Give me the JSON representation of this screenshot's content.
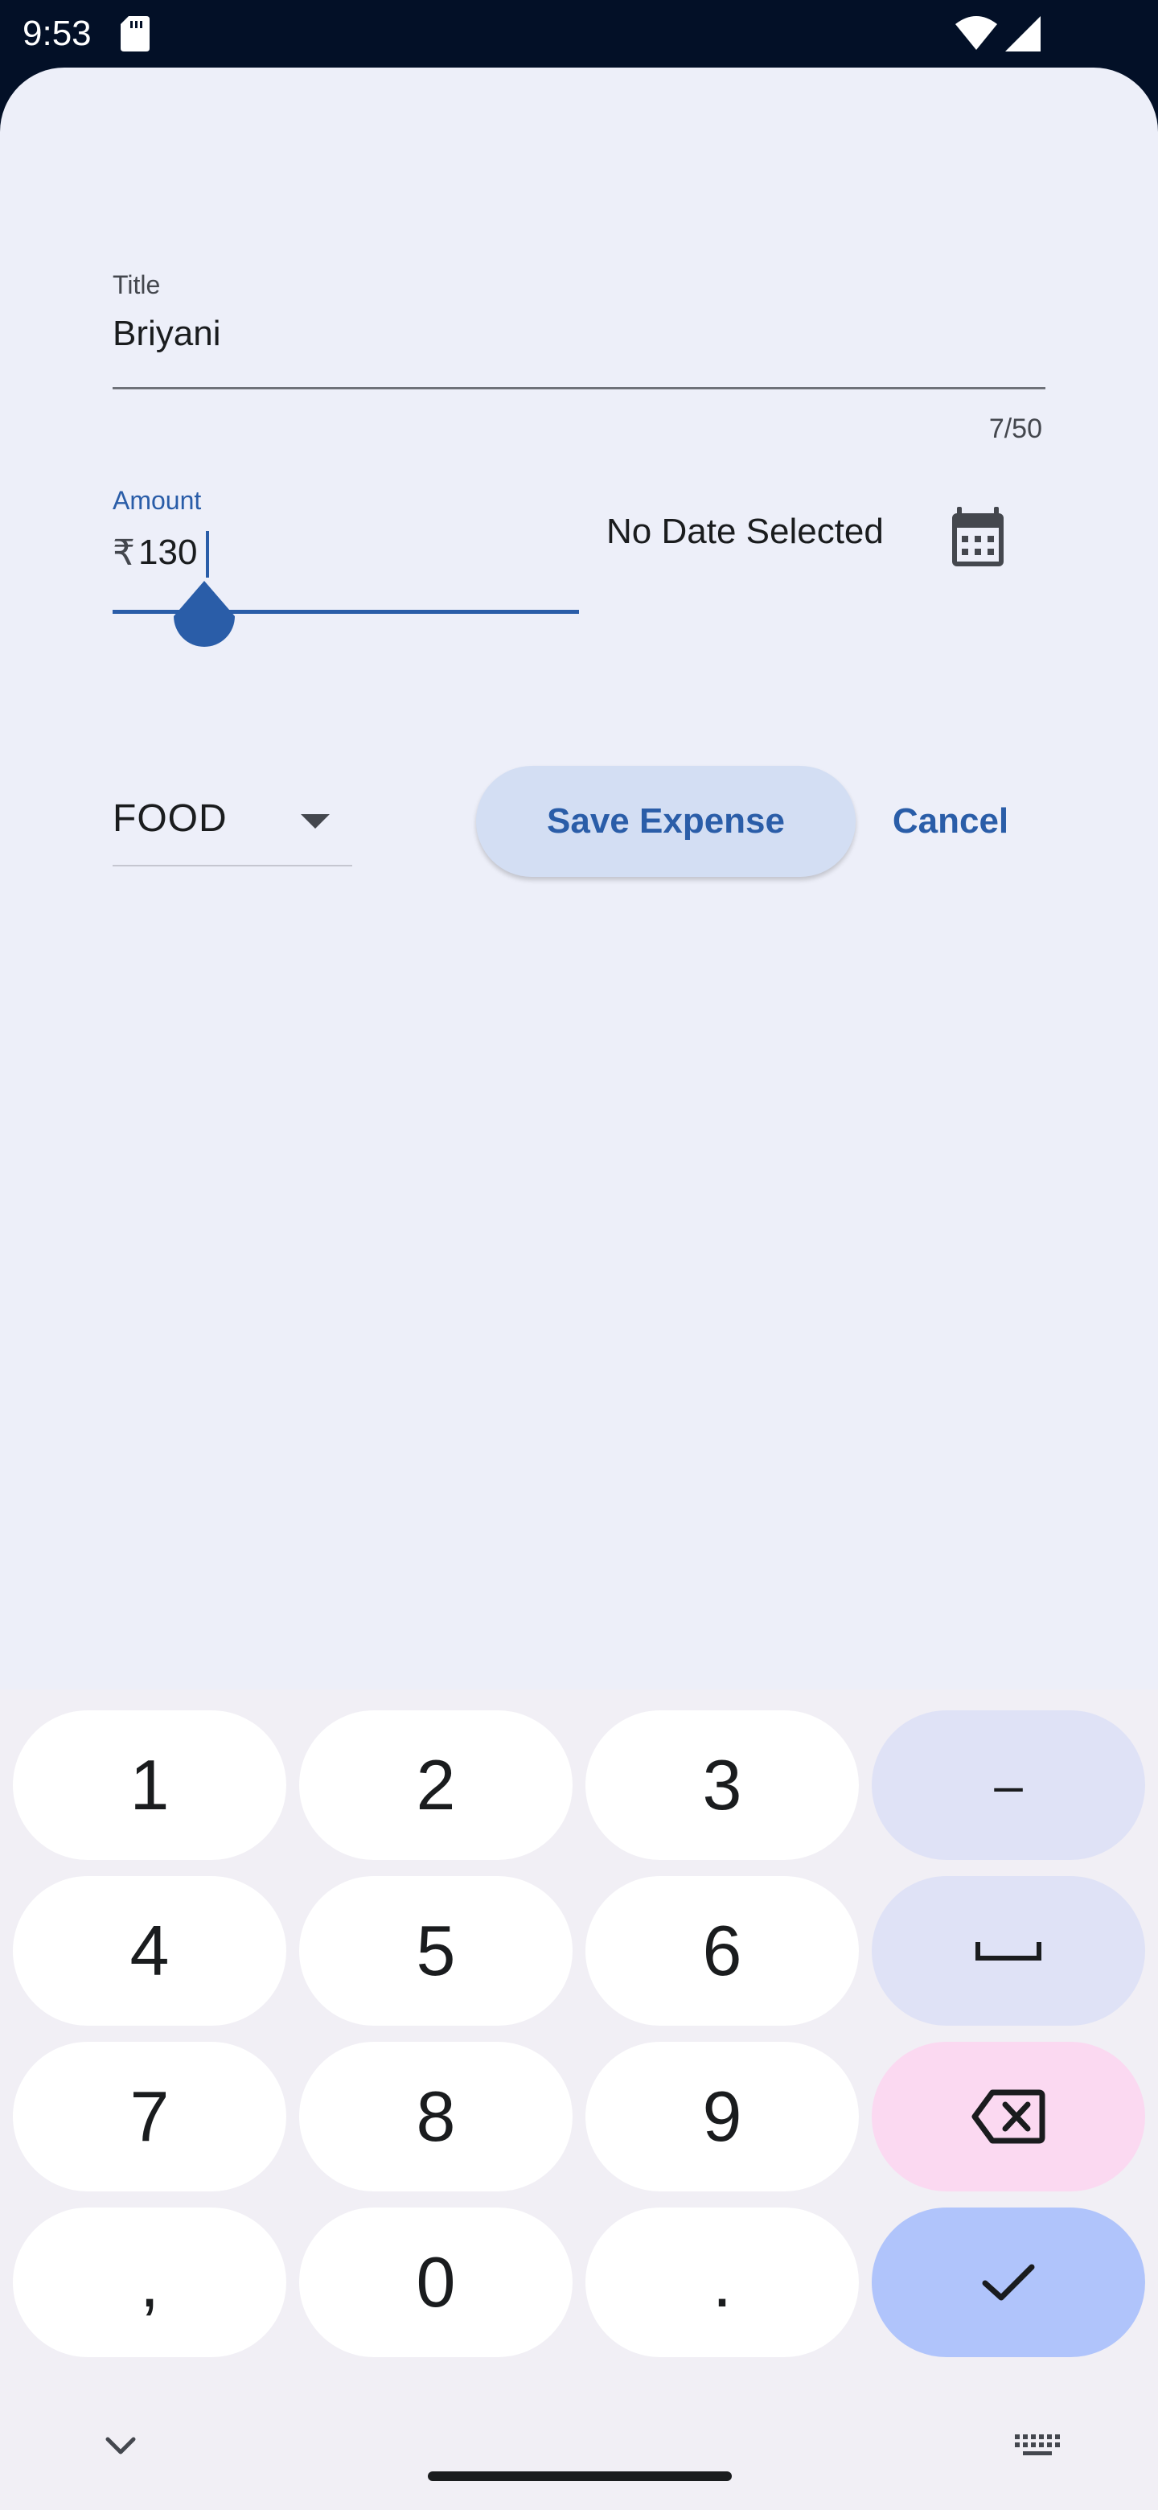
{
  "status_bar": {
    "time": "9:53",
    "icons": [
      "sd-card-icon",
      "wifi-icon",
      "signal-icon"
    ]
  },
  "form": {
    "title_label": "Title",
    "title_value": "Briyani",
    "title_counter": "7/50",
    "amount_label": "Amount",
    "amount_prefix": "₹",
    "amount_value": "130",
    "date_text": "No Date Selected",
    "category_selected": "FOOD",
    "save_label": "Save Expense",
    "cancel_label": "Cancel"
  },
  "keyboard": {
    "keys": [
      "1",
      "2",
      "3",
      "–",
      "4",
      "5",
      "6",
      "␣",
      "7",
      "8",
      "9",
      "⌫",
      ",",
      "0",
      ".",
      "✓"
    ],
    "row1": {
      "k1": "1",
      "k2": "2",
      "k3": "3",
      "k4": "–"
    },
    "row2": {
      "k1": "4",
      "k2": "5",
      "k3": "6"
    },
    "row3": {
      "k1": "7",
      "k2": "8",
      "k3": "9"
    },
    "row4": {
      "k1": ",",
      "k2": "0",
      "k3": "."
    }
  },
  "colors": {
    "accent": "#2a5da8",
    "sheet_background": "#edeff9",
    "status_bar": "#031027",
    "save_button": "#d3def3",
    "delete_key": "#fbd9f1",
    "enter_key": "#b0c4fb"
  }
}
